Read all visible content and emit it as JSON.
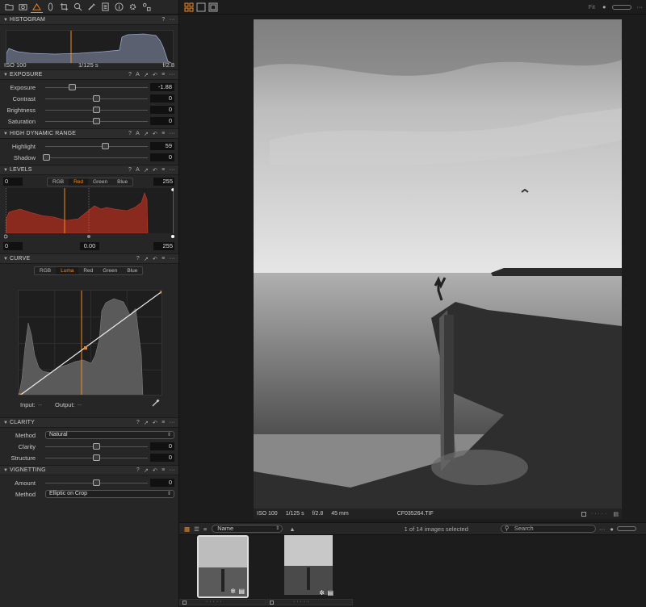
{
  "toolbar": {
    "icons": [
      "folder-icon",
      "camera-icon",
      "adjust-icon",
      "lens-icon",
      "crop-icon",
      "search-icon",
      "picker-icon",
      "text-icon",
      "info-icon",
      "gear-icon",
      "shapes-icon"
    ]
  },
  "histogram": {
    "title": "HISTOGRAM",
    "iso": "ISO 100",
    "shutter": "1/125 s",
    "aperture": "f/2.8"
  },
  "exposure": {
    "title": "EXPOSURE",
    "sliders": [
      {
        "label": "Exposure",
        "value": "-1.88",
        "level": 0.26
      },
      {
        "label": "Contrast",
        "value": "0",
        "level": 0.5
      },
      {
        "label": "Brightness",
        "value": "0",
        "level": 0.5
      },
      {
        "label": "Saturation",
        "value": "0",
        "level": 0.5
      }
    ]
  },
  "hdr": {
    "title": "HIGH DYNAMIC RANGE",
    "sliders": [
      {
        "label": "Highlight",
        "value": "59",
        "level": 0.59
      },
      {
        "label": "Shadow",
        "value": "0",
        "level": 0.0
      }
    ]
  },
  "levels": {
    "title": "LEVELS",
    "in_low": "0",
    "in_high": "255",
    "tabs": [
      "RGB",
      "Red",
      "Green",
      "Blue"
    ],
    "active": "Red",
    "out_low": "0",
    "mid": "0.00",
    "out_high": "255"
  },
  "curve": {
    "title": "CURVE",
    "tabs": [
      "RGB",
      "Luma",
      "Red",
      "Green",
      "Blue"
    ],
    "active": "Luma",
    "input_label": "Input:",
    "input_val": "--",
    "output_label": "Output:",
    "output_val": "--"
  },
  "clarity": {
    "title": "CLARITY",
    "method_label": "Method",
    "method_value": "Natural",
    "sliders": [
      {
        "label": "Clarity",
        "value": "0",
        "level": 0.5
      },
      {
        "label": "Structure",
        "value": "0",
        "level": 0.5
      }
    ]
  },
  "vignetting": {
    "title": "VIGNETTING",
    "amount_label": "Amount",
    "amount_value": "0",
    "amount_level": 0.5,
    "method_label": "Method",
    "method_value": "Elliptic on Crop"
  },
  "viewer": {
    "fit": "Fit",
    "info": {
      "iso": "ISO 100",
      "shutter": "1/125 s",
      "aperture": "f/2.8",
      "focal": "45 mm",
      "filename": "CF035264.TIF"
    }
  },
  "browser": {
    "sort": "Name",
    "count": "1 of 14 images selected",
    "search_placeholder": "Search"
  },
  "colors": {
    "accent": "#f28a24",
    "panel": "#262626",
    "levels_fill": "#8a2a1f"
  }
}
